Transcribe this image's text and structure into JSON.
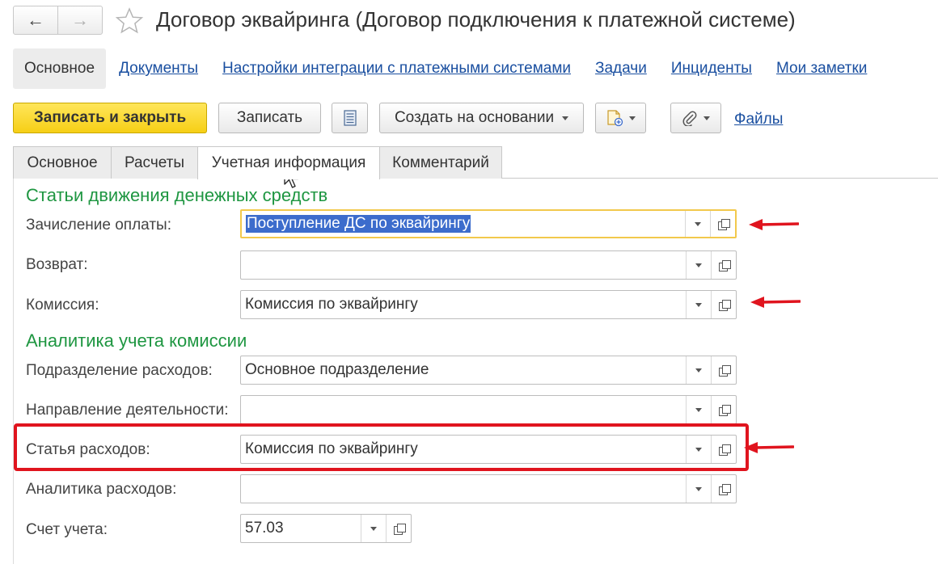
{
  "header": {
    "title": "Договор эквайринга (Договор подключения к платежной системе)",
    "back_icon": "←",
    "forward_icon": "→"
  },
  "top_links": {
    "active": "Основное",
    "items": [
      "Документы",
      "Настройки интеграции с платежными системами",
      "Задачи",
      "Инциденты",
      "Мои заметки"
    ]
  },
  "toolbar": {
    "save_close": "Записать и закрыть",
    "save": "Записать",
    "create_based": "Создать на основании",
    "files": "Файлы"
  },
  "tabs": {
    "items": [
      "Основное",
      "Расчеты",
      "Учетная информация",
      "Комментарий"
    ],
    "active_index": 2
  },
  "sections": {
    "cash_flow": "Статьи движения денежных средств",
    "commission_analytics": "Аналитика учета комиссии"
  },
  "form": {
    "payment_credit": {
      "label": "Зачисление оплаты:",
      "value": "Поступление ДС по эквайрингу"
    },
    "refund": {
      "label": "Возврат:",
      "value": ""
    },
    "commission": {
      "label": "Комиссия:",
      "value": "Комиссия по эквайрингу"
    },
    "expense_division": {
      "label": "Подразделение расходов:",
      "value": "Основное подразделение"
    },
    "activity_direction": {
      "label": "Направление деятельности:",
      "value": ""
    },
    "expense_item": {
      "label": "Статья расходов:",
      "value": "Комиссия по эквайрингу"
    },
    "expense_analytics": {
      "label": "Аналитика расходов:",
      "value": ""
    },
    "account": {
      "label": "Счет учета:",
      "value": "57.03"
    }
  },
  "colors": {
    "accent_green": "#1e9641",
    "link_blue": "#1a4fa0",
    "primary_yellow": "#f6cf16",
    "highlight_red": "#e0141e"
  }
}
